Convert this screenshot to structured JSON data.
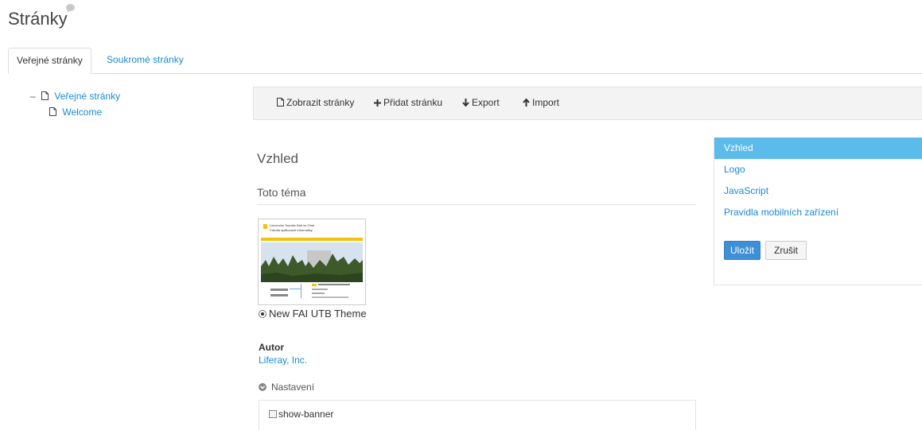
{
  "page": {
    "title": "Stránky"
  },
  "tabs": [
    {
      "label": "Veřejné stránky",
      "active": true
    },
    {
      "label": "Soukromé stránky",
      "active": false
    }
  ],
  "tree": {
    "root_label": "Veřejné stránky",
    "children": [
      {
        "label": "Welcome"
      }
    ]
  },
  "toolbar": {
    "view_label": "Zobrazit stránky",
    "add_label": "Přidat stránku",
    "export_label": "Export",
    "import_label": "Import"
  },
  "main": {
    "section_title": "Vzhled",
    "theme_heading": "Toto téma",
    "theme_name": "New FAI UTB Theme",
    "thumbnail": {
      "header_line1": "Univerzita Tomáše Bati ve Zlíně",
      "header_line2": "Fakulta aplikované informatiky"
    },
    "author_label": "Autor",
    "author_value": "Liferay, Inc.",
    "settings_label": "Nastavení",
    "settings": [
      {
        "label": "show-banner",
        "checked": false
      }
    ]
  },
  "side_nav": {
    "items": [
      {
        "label": "Vzhled",
        "active": true
      },
      {
        "label": "Logo",
        "active": false
      },
      {
        "label": "JavaScript",
        "active": false
      },
      {
        "label": "Pravidla mobilních zařízení",
        "active": false
      }
    ],
    "save_label": "Uložit",
    "cancel_label": "Zrušit"
  },
  "colors": {
    "link": "#1a8ad4",
    "nav_active_bg": "#5bbcec",
    "primary_button": "#3d8fd6"
  }
}
